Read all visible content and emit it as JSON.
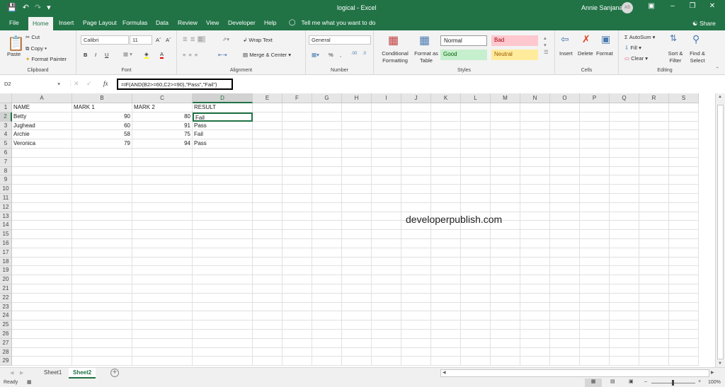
{
  "titlebar": {
    "title": "logical  -  Excel",
    "user": "Annie Sanjana",
    "avatar_initials": "AS",
    "icons": [
      "save-icon",
      "undo-icon",
      "redo-icon",
      "customize-icon"
    ]
  },
  "tabs": [
    "File",
    "Home",
    "Insert",
    "Page Layout",
    "Formulas",
    "Data",
    "Review",
    "View",
    "Developer",
    "Help"
  ],
  "active_tab": "Home",
  "tell_me": "Tell me what you want to do",
  "share": "Share",
  "ribbon": {
    "clipboard": {
      "label": "Clipboard",
      "paste": "Paste",
      "cut": "Cut",
      "copy": "Copy",
      "format_painter": "Format Painter"
    },
    "font": {
      "label": "Font",
      "font_name": "Calibri",
      "font_size": "11",
      "bold": "B",
      "italic": "I",
      "underline": "U"
    },
    "alignment": {
      "label": "Alignment",
      "wrap_text": "Wrap Text",
      "merge_center": "Merge & Center"
    },
    "number": {
      "label": "Number",
      "format": "General",
      "percent": "%",
      "comma": ","
    },
    "styles": {
      "label": "Styles",
      "conditional_formatting": "Conditional Formatting",
      "format_as_table": "Format as Table",
      "normal": "Normal",
      "bad": "Bad",
      "good": "Good",
      "neutral": "Neutral"
    },
    "cells": {
      "label": "Cells",
      "insert": "Insert",
      "delete": "Delete",
      "format": "Format"
    },
    "editing": {
      "label": "Editing",
      "autosum": "AutoSum",
      "fill": "Fill",
      "clear": "Clear",
      "sort_filter": "Sort & Filter",
      "find_select": "Find & Select"
    }
  },
  "formula_bar": {
    "name_box": "D2",
    "fx": "fx",
    "formula": "=IF(AND(B2>=60,C2>=90),\"Pass\",\"Fail\")"
  },
  "sheet": {
    "columns": [
      "A",
      "B",
      "C",
      "D",
      "E",
      "F",
      "G",
      "H",
      "I",
      "J",
      "K",
      "L",
      "M",
      "N",
      "O",
      "P",
      "Q",
      "R",
      "S"
    ],
    "rows": [
      1,
      2,
      3,
      4,
      5,
      6,
      7,
      8,
      9,
      10,
      11,
      12,
      13,
      14,
      15,
      16,
      17,
      18,
      19,
      20,
      21,
      22,
      23,
      24,
      25,
      26,
      27,
      28,
      29
    ],
    "active_cell": "D2",
    "data": [
      [
        "NAME",
        "MARK 1",
        "MARK 2",
        "RESULT"
      ],
      [
        "Betty",
        "90",
        "80",
        "Fail"
      ],
      [
        "Jughead",
        "60",
        "91",
        "Pass"
      ],
      [
        "Archie",
        "58",
        "75",
        "Fail"
      ],
      [
        "Veronica",
        "79",
        "94",
        "Pass"
      ]
    ]
  },
  "watermark": "developerpublish.com",
  "sheet_tabs": [
    "Sheet1",
    "Sheet2"
  ],
  "active_sheet": "Sheet2",
  "status": {
    "ready": "Ready",
    "zoom": "100%"
  },
  "colors": {
    "brand": "#217346",
    "bad_bg": "#ffc7ce",
    "bad_fg": "#9c0006",
    "good_bg": "#c6efce",
    "good_fg": "#006100",
    "neutral_bg": "#ffeb9c",
    "neutral_fg": "#9c5700"
  }
}
